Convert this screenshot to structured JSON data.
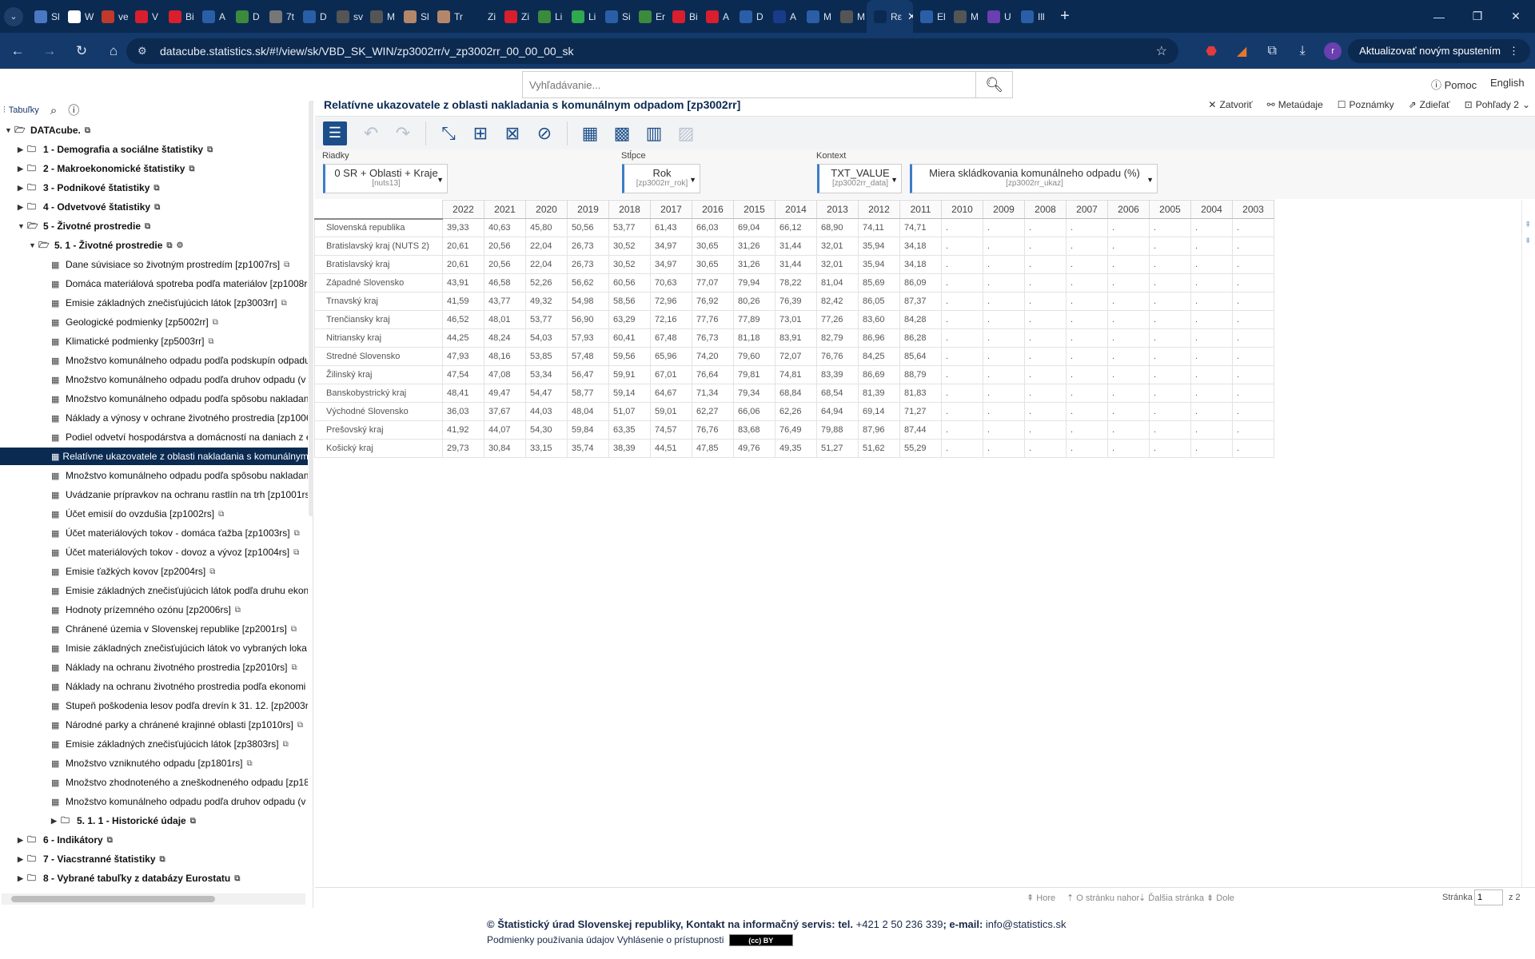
{
  "browser": {
    "tabs": [
      {
        "label": "Sl",
        "color": "#4a78c2"
      },
      {
        "label": "W",
        "color": "#ffffff"
      },
      {
        "label": "ve",
        "color": "#c0392b"
      },
      {
        "label": "V",
        "color": "#d91e2e"
      },
      {
        "label": "Bi",
        "color": "#d91e2e"
      },
      {
        "label": "A",
        "color": "#2a5fa8"
      },
      {
        "label": "D",
        "color": "#3c8a3c"
      },
      {
        "label": "7t",
        "color": "#777777"
      },
      {
        "label": "D",
        "color": "#2a5fa8"
      },
      {
        "label": "sv",
        "color": "#555555"
      },
      {
        "label": "M",
        "color": "#555555"
      },
      {
        "label": "Sl",
        "color": "#b5876a"
      },
      {
        "label": "Tr",
        "color": "#b5876a"
      },
      {
        "label": "Zi",
        "color": "#0a2a52"
      },
      {
        "label": "Zi",
        "color": "#d91e2e"
      },
      {
        "label": "Li",
        "color": "#3c8a3c"
      },
      {
        "label": "Li",
        "color": "#2fa84f"
      },
      {
        "label": "Si",
        "color": "#2a5fa8"
      },
      {
        "label": "Er",
        "color": "#3c8a3c"
      },
      {
        "label": "Bi",
        "color": "#d91e2e"
      },
      {
        "label": "A",
        "color": "#d91e2e"
      },
      {
        "label": "D",
        "color": "#2a5fa8"
      },
      {
        "label": "A",
        "color": "#1a3a8a"
      },
      {
        "label": "M",
        "color": "#2a5fa8"
      },
      {
        "label": "M",
        "color": "#555555"
      },
      {
        "label": "Rε",
        "color": "#0a2a52",
        "active": true
      },
      {
        "label": "El",
        "color": "#2a5fa8"
      },
      {
        "label": "M",
        "color": "#555555"
      },
      {
        "label": "U",
        "color": "#6a3fb0"
      },
      {
        "label": "Ill",
        "color": "#2a5fa8"
      }
    ],
    "url": "datacube.statistics.sk/#!/view/sk/VBD_SK_WIN/zp3002rr/v_zp3002rr_00_00_00_sk",
    "update_button": "Aktualizovať novým spustením",
    "profile_initial": "r"
  },
  "header": {
    "search_placeholder": "Vyhľadávanie...",
    "help": "Pomoc",
    "language": "English"
  },
  "sidebar": {
    "tab_label": "Tabuľky",
    "tree": [
      {
        "label": "DATAcube.",
        "depth": 0,
        "type": "root",
        "bold": true,
        "ext": true
      },
      {
        "label": "1 - Demografia a sociálne štatistiky",
        "depth": 1,
        "type": "folder",
        "bold": true,
        "ext": true
      },
      {
        "label": "2 - Makroekonomické štatistiky",
        "depth": 1,
        "type": "folder",
        "bold": true,
        "ext": true
      },
      {
        "label": "3 - Podnikové štatistiky",
        "depth": 1,
        "type": "folder",
        "bold": true,
        "ext": true
      },
      {
        "label": "4 - Odvetvové štatistiky",
        "depth": 1,
        "type": "folder",
        "bold": true,
        "ext": true
      },
      {
        "label": "5 - Životné prostredie",
        "depth": 1,
        "type": "folder-open",
        "bold": true,
        "ext": true
      },
      {
        "label": "5. 1 - Životné prostredie",
        "depth": 2,
        "type": "folder-open",
        "bold": true,
        "ext": true,
        "gear": true
      },
      {
        "label": "Dane súvisiace so životným prostredím [zp1007rs]",
        "depth": 3,
        "type": "table",
        "ext": true
      },
      {
        "label": "Domáca materiálová spotreba podľa materiálov [zp1008rs]",
        "depth": 3,
        "type": "table"
      },
      {
        "label": "Emisie základných znečisťujúcich látok [zp3003rr]",
        "depth": 3,
        "type": "table",
        "ext": true
      },
      {
        "label": "Geologické podmienky [zp5002rr]",
        "depth": 3,
        "type": "table",
        "ext": true
      },
      {
        "label": "Klimatické podmienky [zp5003rr]",
        "depth": 3,
        "type": "table",
        "ext": true
      },
      {
        "label": "Množstvo komunálneho odpadu podľa podskupín odpadu",
        "depth": 3,
        "type": "table"
      },
      {
        "label": "Množstvo komunálneho odpadu podľa druhov odpadu (v",
        "depth": 3,
        "type": "table"
      },
      {
        "label": "Množstvo komunálneho odpadu podľa spôsobu nakladani",
        "depth": 3,
        "type": "table"
      },
      {
        "label": "Náklady a výnosy v ochrane životného prostredia [zp1006",
        "depth": 3,
        "type": "table"
      },
      {
        "label": "Podiel odvetví hospodárstva a domácností na daniach z e",
        "depth": 3,
        "type": "table"
      },
      {
        "label": "Relatívne ukazovatele z oblasti nakladania s komunálnym",
        "depth": 3,
        "type": "table",
        "selected": true
      },
      {
        "label": "Množstvo komunálneho odpadu podľa spôsobu nakladani",
        "depth": 3,
        "type": "table"
      },
      {
        "label": "Uvádzanie prípravkov na ochranu rastlín na trh [zp1001rs",
        "depth": 3,
        "type": "table"
      },
      {
        "label": "Účet emisií do ovzdušia [zp1002rs]",
        "depth": 3,
        "type": "table",
        "ext": true
      },
      {
        "label": "Účet materiálových tokov - domáca ťažba [zp1003rs]",
        "depth": 3,
        "type": "table",
        "ext": true
      },
      {
        "label": "Účet materiálových tokov - dovoz a vývoz [zp1004rs]",
        "depth": 3,
        "type": "table",
        "ext": true
      },
      {
        "label": "Emisie ťažkých kovov [zp2004rs]",
        "depth": 3,
        "type": "table",
        "ext": true
      },
      {
        "label": "Emisie základných znečisťujúcich látok podľa druhu ekon",
        "depth": 3,
        "type": "table"
      },
      {
        "label": "Hodnoty prízemného ozónu [zp2006rs]",
        "depth": 3,
        "type": "table",
        "ext": true
      },
      {
        "label": "Chránené územia v Slovenskej republike [zp2001rs]",
        "depth": 3,
        "type": "table",
        "ext": true
      },
      {
        "label": "Imisie základných znečisťujúcich látok vo vybraných loka",
        "depth": 3,
        "type": "table"
      },
      {
        "label": "Náklady na ochranu životného prostredia [zp2010rs]",
        "depth": 3,
        "type": "table",
        "ext": true
      },
      {
        "label": "Náklady na ochranu životného prostredia podľa ekonomi",
        "depth": 3,
        "type": "table"
      },
      {
        "label": "Stupeň poškodenia lesov podľa drevín k 31. 12. [zp2003r",
        "depth": 3,
        "type": "table"
      },
      {
        "label": "Národné parky a chránené krajinné oblasti [zp1010rs]",
        "depth": 3,
        "type": "table",
        "ext": true
      },
      {
        "label": "Emisie základných znečisťujúcich látok [zp3803rs]",
        "depth": 3,
        "type": "table",
        "ext": true
      },
      {
        "label": "Množstvo vzniknutého odpadu [zp1801rs]",
        "depth": 3,
        "type": "table",
        "ext": true
      },
      {
        "label": "Množstvo zhodnoteného a zneškodneného odpadu [zp18",
        "depth": 3,
        "type": "table"
      },
      {
        "label": "Množstvo komunálneho odpadu podľa druhov odpadu (v",
        "depth": 3,
        "type": "table"
      },
      {
        "label": "5. 1. 1 - Historické údaje",
        "depth": 3,
        "type": "folder",
        "bold": true,
        "ext": true
      },
      {
        "label": "6 - Indikátory",
        "depth": 1,
        "type": "folder",
        "bold": true,
        "ext": true
      },
      {
        "label": "7 - Viacstranné štatistiky",
        "depth": 1,
        "type": "folder",
        "bold": true,
        "ext": true
      },
      {
        "label": "8 - Vybrané tabuľky z databázy Eurostatu",
        "depth": 1,
        "type": "folder",
        "bold": true,
        "ext": true
      }
    ]
  },
  "main": {
    "title": "Relatívne ukazovatele z oblasti nakladania s komunálnym odpadom [zp3002rr]",
    "actions": {
      "close": "Zatvoriť",
      "metadata": "Metaúdaje",
      "notes": "Poznámky",
      "share": "Zdieľať",
      "views": "Pohľady 2"
    },
    "selectors": {
      "rows_label": "Riadky",
      "rows_value": "0 SR + Oblasti + Kraje",
      "rows_code": "[nuts13]",
      "cols_label": "Stĺpce",
      "cols_value": "Rok",
      "cols_code": "[zp3002rr_rok]",
      "ctx_label": "Kontext",
      "ctx1_value": "TXT_VALUE",
      "ctx1_code": "[zp3002rr_data]",
      "ctx2_value": "Miera skládkovania komunálneho odpadu (%)",
      "ctx2_code": "[zp3002rr_ukaz]"
    },
    "columns": [
      "2022",
      "2021",
      "2020",
      "2019",
      "2018",
      "2017",
      "2016",
      "2015",
      "2014",
      "2013",
      "2012",
      "2011",
      "2010",
      "2009",
      "2008",
      "2007",
      "2006",
      "2005",
      "2004",
      "2003"
    ],
    "rows": [
      {
        "name": "Slovenská republika",
        "values": [
          "39,33",
          "40,63",
          "45,80",
          "50,56",
          "53,77",
          "61,43",
          "66,03",
          "69,04",
          "66,12",
          "68,90",
          "74,11",
          "74,71",
          ".",
          ".",
          ".",
          ".",
          ".",
          ".",
          ".",
          "."
        ]
      },
      {
        "name": "Bratislavský kraj (NUTS 2)",
        "values": [
          "20,61",
          "20,56",
          "22,04",
          "26,73",
          "30,52",
          "34,97",
          "30,65",
          "31,26",
          "31,44",
          "32,01",
          "35,94",
          "34,18",
          ".",
          ".",
          ".",
          ".",
          ".",
          ".",
          ".",
          "."
        ]
      },
      {
        "name": "Bratislavský kraj",
        "values": [
          "20,61",
          "20,56",
          "22,04",
          "26,73",
          "30,52",
          "34,97",
          "30,65",
          "31,26",
          "31,44",
          "32,01",
          "35,94",
          "34,18",
          ".",
          ".",
          ".",
          ".",
          ".",
          ".",
          ".",
          "."
        ]
      },
      {
        "name": "Západné Slovensko",
        "values": [
          "43,91",
          "46,58",
          "52,26",
          "56,62",
          "60,56",
          "70,63",
          "77,07",
          "79,94",
          "78,22",
          "81,04",
          "85,69",
          "86,09",
          ".",
          ".",
          ".",
          ".",
          ".",
          ".",
          ".",
          "."
        ]
      },
      {
        "name": "Trnavský kraj",
        "values": [
          "41,59",
          "43,77",
          "49,32",
          "54,98",
          "58,56",
          "72,96",
          "76,92",
          "80,26",
          "76,39",
          "82,42",
          "86,05",
          "87,37",
          ".",
          ".",
          ".",
          ".",
          ".",
          ".",
          ".",
          "."
        ]
      },
      {
        "name": "Trenčiansky kraj",
        "values": [
          "46,52",
          "48,01",
          "53,77",
          "56,90",
          "63,29",
          "72,16",
          "77,76",
          "77,89",
          "73,01",
          "77,26",
          "83,60",
          "84,28",
          ".",
          ".",
          ".",
          ".",
          ".",
          ".",
          ".",
          "."
        ]
      },
      {
        "name": "Nitriansky kraj",
        "values": [
          "44,25",
          "48,24",
          "54,03",
          "57,93",
          "60,41",
          "67,48",
          "76,73",
          "81,18",
          "83,91",
          "82,79",
          "86,96",
          "86,28",
          ".",
          ".",
          ".",
          ".",
          ".",
          ".",
          ".",
          "."
        ]
      },
      {
        "name": "Stredné Slovensko",
        "values": [
          "47,93",
          "48,16",
          "53,85",
          "57,48",
          "59,56",
          "65,96",
          "74,20",
          "79,60",
          "72,07",
          "76,76",
          "84,25",
          "85,64",
          ".",
          ".",
          ".",
          ".",
          ".",
          ".",
          ".",
          "."
        ]
      },
      {
        "name": "Žilinský kraj",
        "values": [
          "47,54",
          "47,08",
          "53,34",
          "56,47",
          "59,91",
          "67,01",
          "76,64",
          "79,81",
          "74,81",
          "83,39",
          "86,69",
          "88,79",
          ".",
          ".",
          ".",
          ".",
          ".",
          ".",
          ".",
          "."
        ]
      },
      {
        "name": "Banskobystrický kraj",
        "values": [
          "48,41",
          "49,47",
          "54,47",
          "58,77",
          "59,14",
          "64,67",
          "71,34",
          "79,34",
          "68,84",
          "68,54",
          "81,39",
          "81,83",
          ".",
          ".",
          ".",
          ".",
          ".",
          ".",
          ".",
          "."
        ]
      },
      {
        "name": "Východné Slovensko",
        "values": [
          "36,03",
          "37,67",
          "44,03",
          "48,04",
          "51,07",
          "59,01",
          "62,27",
          "66,06",
          "62,26",
          "64,94",
          "69,14",
          "71,27",
          ".",
          ".",
          ".",
          ".",
          ".",
          ".",
          ".",
          "."
        ]
      },
      {
        "name": "Prešovský kraj",
        "values": [
          "41,92",
          "44,07",
          "54,30",
          "59,84",
          "63,35",
          "74,57",
          "76,76",
          "83,68",
          "76,49",
          "79,88",
          "87,96",
          "87,44",
          ".",
          ".",
          ".",
          ".",
          ".",
          ".",
          ".",
          "."
        ]
      },
      {
        "name": "Košický kraj",
        "values": [
          "29,73",
          "30,84",
          "33,15",
          "35,74",
          "38,39",
          "44,51",
          "47,85",
          "49,76",
          "49,35",
          "51,27",
          "51,62",
          "55,29",
          ".",
          ".",
          ".",
          ".",
          ".",
          ".",
          ".",
          "."
        ]
      }
    ]
  },
  "pager": {
    "top": "Hore",
    "page_up": "O stránku nahor",
    "next_page": "Ďalšia stránka",
    "down": "Dole",
    "page_label": "Stránka",
    "page_value": "1",
    "page_total": "z 2"
  },
  "footer": {
    "line1_prefix": "© Štatistický úrad Slovenskej republiky, Kontakt na informačný servis: tel.",
    "phone": "+421 2 50 236 339",
    "email_label": "; e-mail:",
    "email": "info@statistics.sk",
    "terms": "Podmienky používania údajov",
    "accessibility": "Vyhlásenie o prístupnosti",
    "cc_badge": "(cc) BY"
  }
}
